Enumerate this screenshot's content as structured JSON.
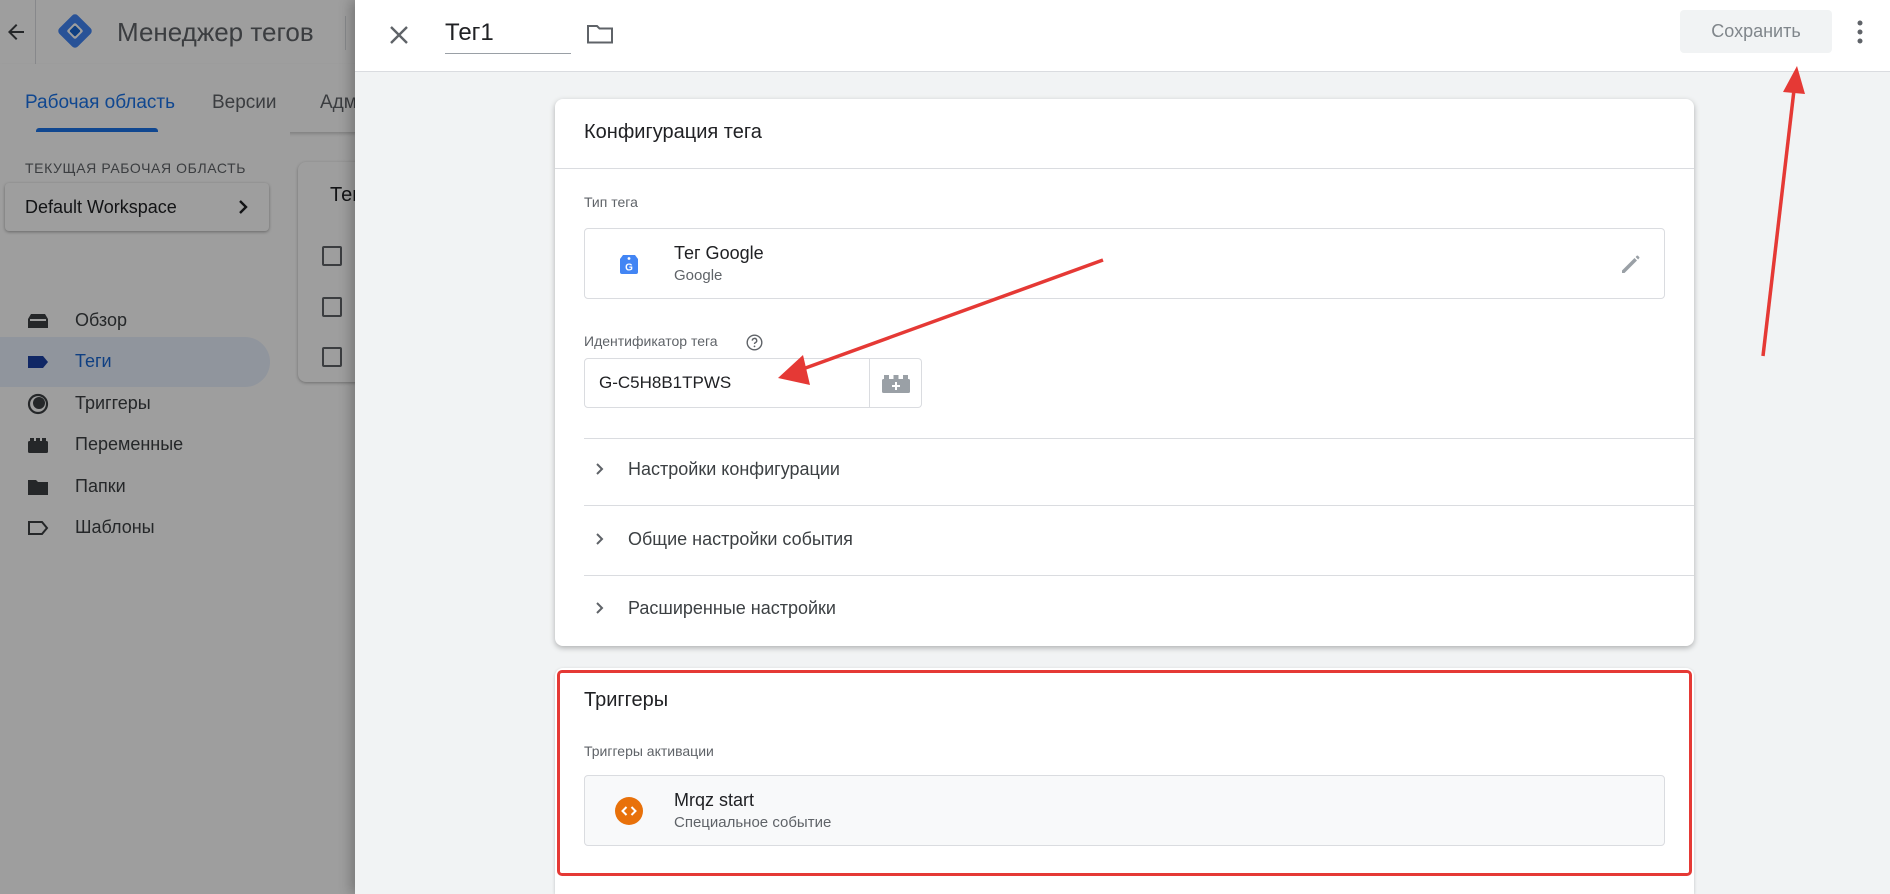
{
  "app": {
    "title": "Менеджер тегов",
    "tabs": [
      "Рабочая область",
      "Версии",
      "Адм"
    ],
    "workspace_caption": "ТЕКУЩАЯ РАБОЧАЯ ОБЛАСТЬ",
    "workspace_name": "Default Workspace",
    "nav": [
      {
        "label": "Обзор",
        "icon": "overview-icon"
      },
      {
        "label": "Теги",
        "icon": "tag-icon",
        "active": true
      },
      {
        "label": "Триггеры",
        "icon": "trigger-icon"
      },
      {
        "label": "Переменные",
        "icon": "variables-icon"
      },
      {
        "label": "Папки",
        "icon": "folder-icon"
      },
      {
        "label": "Шаблоны",
        "icon": "template-icon"
      }
    ],
    "content_title_fragment": "Тег"
  },
  "editor": {
    "tag_name": "Тег1",
    "save_label": "Сохранить",
    "config": {
      "title": "Конфигурация тега",
      "tag_type_label": "Тип тега",
      "tag_type_name": "Тег Google",
      "tag_type_vendor": "Google",
      "tag_id_label": "Идентификатор тега",
      "tag_id_value": "G-C5H8B1TPWS",
      "sections": [
        "Настройки конфигурации",
        "Общие настройки события",
        "Расширенные настройки"
      ]
    },
    "triggers": {
      "title": "Триггеры",
      "subtitle": "Триггеры активации",
      "items": [
        {
          "name": "Mrqz start",
          "type": "Специальное событие"
        }
      ]
    }
  },
  "colors": {
    "accent": "#1a73e8",
    "annotation": "#e53935",
    "trigger_icon": "#e8710a",
    "google_tag_icon": "#4285f4"
  }
}
